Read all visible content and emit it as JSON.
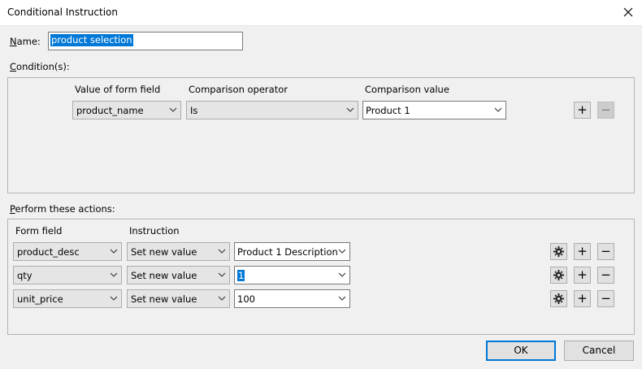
{
  "window": {
    "title": "Conditional Instruction"
  },
  "name": {
    "label": "Name:",
    "value": "product selection"
  },
  "conditions": {
    "section_label": "Condition(s):",
    "headers": {
      "field": "Value of form field",
      "operator": "Comparison operator",
      "value": "Comparison value"
    },
    "rows": [
      {
        "field": "product_name",
        "operator": "Is",
        "value": "Product 1"
      }
    ],
    "add_label": "+",
    "remove_label": "−"
  },
  "actions": {
    "section_label": "Perform these actions:",
    "headers": {
      "field": "Form field",
      "instruction": "Instruction"
    },
    "rows": [
      {
        "field": "product_desc",
        "instruction": "Set new value",
        "value": "Product 1 Description"
      },
      {
        "field": "qty",
        "instruction": "Set new value",
        "value": "1"
      },
      {
        "field": "unit_price",
        "instruction": "Set new value",
        "value": "100"
      }
    ],
    "add_label": "+",
    "remove_label": "−"
  },
  "buttons": {
    "ok": "OK",
    "cancel": "Cancel"
  },
  "icons": {
    "close": "close-icon",
    "chevron": "chevron-down-icon",
    "gear": "gear-icon"
  },
  "colors": {
    "selection": "#0078d7",
    "default_button_border": "#0078d7"
  }
}
